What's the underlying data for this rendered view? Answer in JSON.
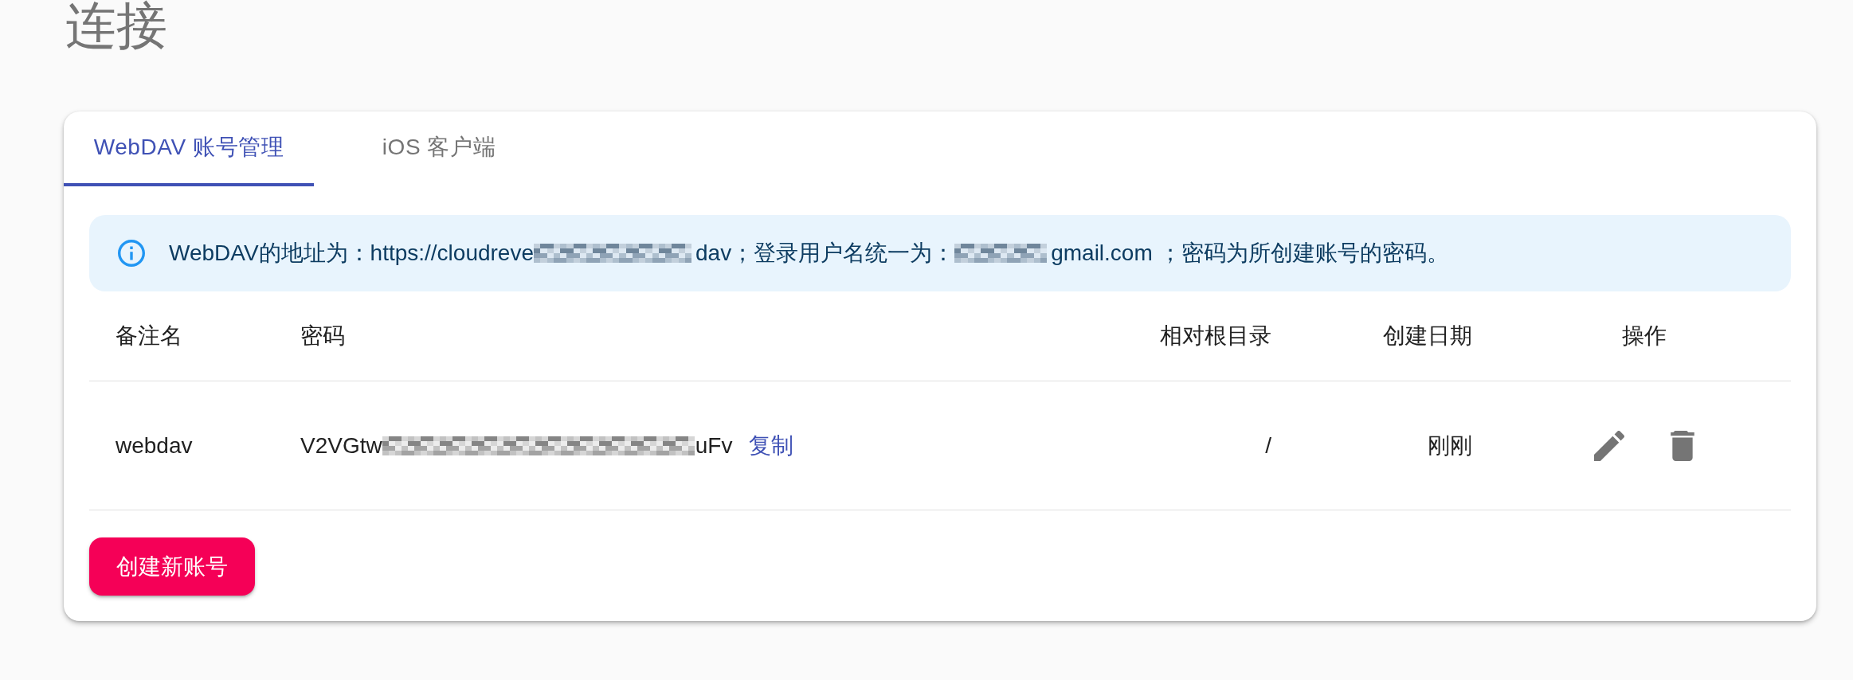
{
  "page": {
    "title": "连接"
  },
  "tabs": [
    {
      "label": "WebDAV 账号管理",
      "selected": true
    },
    {
      "label": "iOS 客户端",
      "selected": false
    }
  ],
  "alert": {
    "segments": [
      {
        "kind": "text",
        "text": "WebDAV的地址为：https://cloudreve"
      },
      {
        "kind": "redacted"
      },
      {
        "kind": "text",
        "text": "dav；登录用户名统一为："
      },
      {
        "kind": "redacted"
      },
      {
        "kind": "text",
        "text": "gmail.com ；密码为所创建账号的密码。"
      }
    ]
  },
  "table": {
    "columns": [
      {
        "label": "备注名"
      },
      {
        "label": "密码"
      },
      {
        "label": "相对根目录"
      },
      {
        "label": "创建日期"
      },
      {
        "label": "操作"
      }
    ],
    "rows": [
      {
        "name": "webdav",
        "password": [
          {
            "kind": "text",
            "text": "V2VGtw"
          },
          {
            "kind": "redacted"
          },
          {
            "kind": "text",
            "text": "uFv"
          }
        ],
        "copy_link": "复制",
        "root": "/",
        "created": "刚刚",
        "actions": [
          {
            "kind": "edit"
          },
          {
            "kind": "delete"
          }
        ]
      }
    ]
  },
  "create_button": {
    "label": "创建新账号"
  }
}
